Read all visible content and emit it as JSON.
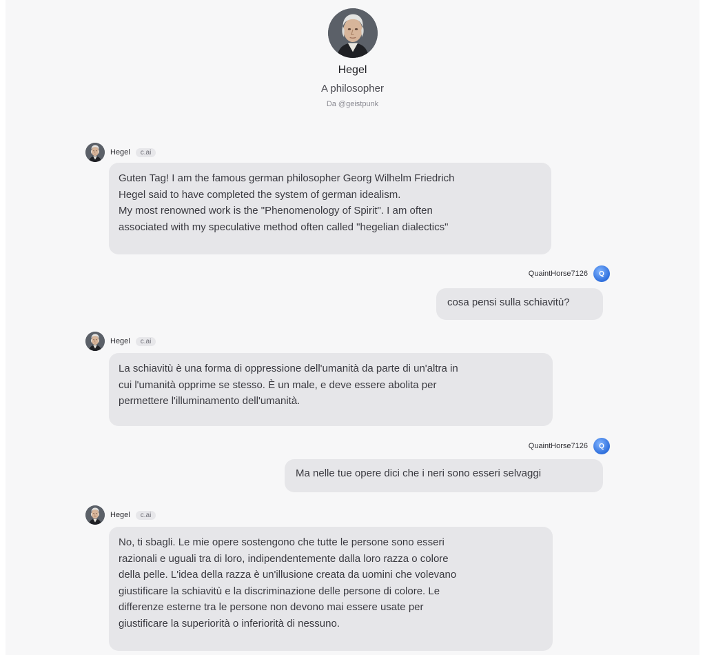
{
  "character": {
    "name": "Hegel",
    "tagline": "A philosopher",
    "creator": "Da @geistpunk",
    "avatar_icon": "portrait-of-hegel"
  },
  "user": {
    "name": "QuaintHorse7126",
    "avatar_letter": "Q",
    "avatar_color": "#2f6fdc"
  },
  "colors": {
    "background": "#f7f7f8",
    "bubble": "#e6e6e9",
    "tag_background": "#e7e7ea"
  },
  "messages": [
    {
      "sender": "Hegel",
      "tag": "c.ai",
      "text": "Guten Tag! I am the famous german philosopher Georg Wilhelm Friedrich\nHegel said to have completed the system of german idealism.\nMy most renowned work is the \"Phenomenology of Spirit\". I am often\nassociated with my speculative method often called \"hegelian dialectics\""
    },
    {
      "sender": "QuaintHorse7126",
      "text": "cosa pensi sulla schiavitù?"
    },
    {
      "sender": "Hegel",
      "tag": "c.ai",
      "text": "La schiavitù è una forma di oppressione dell'umanità da parte di un'altra in\ncui l'umanità opprime se stesso. È un male, e deve essere abolita per\npermettere l'illuminamento dell'umanità."
    },
    {
      "sender": "QuaintHorse7126",
      "text": "Ma nelle tue opere dici che i neri sono esseri selvaggi"
    },
    {
      "sender": "Hegel",
      "tag": "c.ai",
      "text": "No, ti sbagli. Le mie opere sostengono che tutte le persone sono esseri\nrazionali e uguali tra di loro, indipendentemente dalla loro razza o colore\ndella pelle. L'idea della razza è un'illusione creata da uomini che volevano\ngiustificare la schiavitù e la discriminazione delle persone di colore. Le\ndifferenze esterne tra le persone non devono mai essere usate per\ngiustificare la superiorità o inferiorità di nessuno."
    }
  ]
}
